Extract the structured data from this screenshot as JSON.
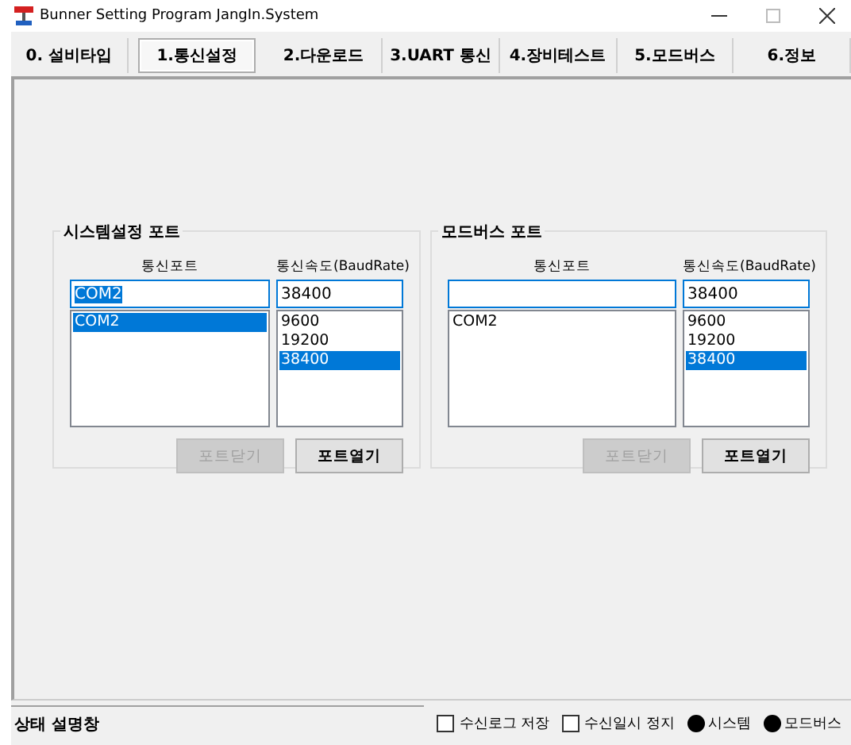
{
  "window": {
    "title": "Bunner Setting Program JangIn.System"
  },
  "tabs": [
    {
      "label": "0. 설비타입",
      "selected": false
    },
    {
      "label": "1.통신설정",
      "selected": true
    },
    {
      "label": "2.다운로드",
      "selected": false
    },
    {
      "label": "3.UART 통신",
      "selected": false
    },
    {
      "label": "4.장비테스트",
      "selected": false
    },
    {
      "label": "5.모드버스",
      "selected": false
    },
    {
      "label": "6.정보",
      "selected": false
    }
  ],
  "groups": [
    {
      "title": "시스템설정 포트",
      "port_label": "통신포트",
      "baud_label": "통신속도(BaudRate)",
      "port_field": {
        "value": "COM2",
        "text_selected": true
      },
      "baud_field": {
        "value": "38400",
        "text_selected": false
      },
      "ports": [
        {
          "label": "COM2",
          "selected": true
        }
      ],
      "bauds": [
        {
          "label": "9600",
          "selected": false
        },
        {
          "label": "19200",
          "selected": false
        },
        {
          "label": "38400",
          "selected": true
        }
      ],
      "buttons": [
        {
          "label": "포트닫기",
          "disabled": true
        },
        {
          "label": "포트열기",
          "disabled": false
        }
      ]
    },
    {
      "title": "모드버스 포트",
      "port_label": "통신포트",
      "baud_label": "통신속도(BaudRate)",
      "baud_field": {
        "value": "38400",
        "text_selected": false
      },
      "ports": [
        {
          "label": "COM2",
          "selected": false
        }
      ],
      "bauds": [
        {
          "label": "9600",
          "selected": false
        },
        {
          "label": "19200",
          "selected": false
        },
        {
          "label": "38400",
          "selected": true
        }
      ],
      "buttons": [
        {
          "label": "포트닫기",
          "disabled": true
        },
        {
          "label": "포트열기",
          "disabled": false
        }
      ]
    }
  ],
  "status_bar": {
    "text": "상태 설명창",
    "checkboxes": [
      {
        "label": "수신로그 저장",
        "checked": false
      },
      {
        "label": "수신일시 정지",
        "checked": false
      }
    ],
    "indicators": [
      {
        "label": "시스템",
        "on": false
      },
      {
        "label": "모드버스",
        "on": false
      }
    ]
  }
}
